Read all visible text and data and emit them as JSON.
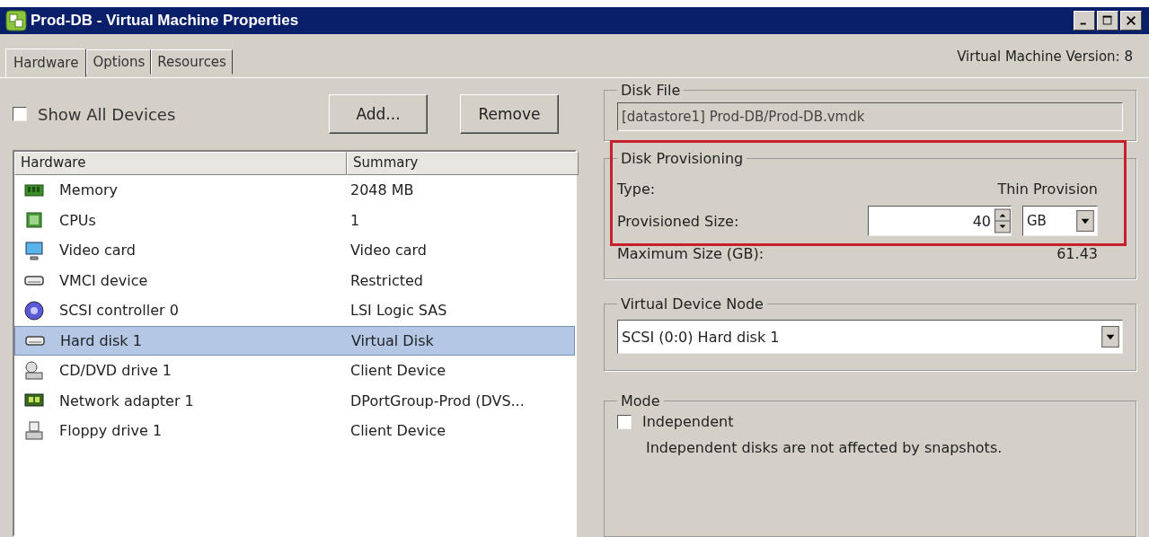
{
  "window": {
    "title": "Prod-DB - Virtual Machine Properties"
  },
  "tabs": [
    {
      "label": "Hardware",
      "selected": true
    },
    {
      "label": "Options",
      "selected": false
    },
    {
      "label": "Resources",
      "selected": false
    }
  ],
  "version": "Virtual Machine Version: 8",
  "show_all_devices": {
    "label": "Show All Devices",
    "checked": false
  },
  "buttons": [
    "Add...",
    "Remove"
  ],
  "table": {
    "columns": [
      "Hardware",
      "Summary"
    ],
    "rows": [
      {
        "kind": "memory",
        "name": "Memory",
        "summary": "2048 MB",
        "selected": false
      },
      {
        "kind": "cpu",
        "name": "CPUs",
        "summary": "1",
        "selected": false
      },
      {
        "kind": "monitor",
        "name": "Video card",
        "summary": "Video card",
        "selected": false
      },
      {
        "kind": "device",
        "name": "VMCI device",
        "summary": "Restricted",
        "selected": false
      },
      {
        "kind": "controller",
        "name": "SCSI controller 0",
        "summary": "LSI Logic SAS",
        "selected": false
      },
      {
        "kind": "device",
        "name": "Hard disk 1",
        "summary": "Virtual Disk",
        "selected": true
      },
      {
        "kind": "cd",
        "name": "CD/DVD drive 1",
        "summary": "Client Device",
        "selected": false
      },
      {
        "kind": "network",
        "name": "Network adapter 1",
        "summary": "DPortGroup-Prod (DVS...",
        "selected": false
      },
      {
        "kind": "floppy",
        "name": "Floppy drive 1",
        "summary": "Client Device",
        "selected": false
      }
    ]
  },
  "disk_file": {
    "title": "Disk File",
    "value": "[datastore1] Prod-DB/Prod-DB.vmdk"
  },
  "disk_provisioning": {
    "title": "Disk Provisioning",
    "type_label": "Type:",
    "type_value": "Thin Provision",
    "size_label": "Provisioned Size:",
    "size_value": "40",
    "unit": "GB",
    "max_label": "Maximum Size (GB):",
    "max_value": "61.43"
  },
  "virtual_device_node": {
    "title": "Virtual Device Node",
    "value": "SCSI (0:0) Hard disk 1"
  },
  "mode": {
    "title": "Mode",
    "independent": {
      "label": "Independent",
      "checked": false
    },
    "note": "Independent disks are not affected by snapshots."
  }
}
